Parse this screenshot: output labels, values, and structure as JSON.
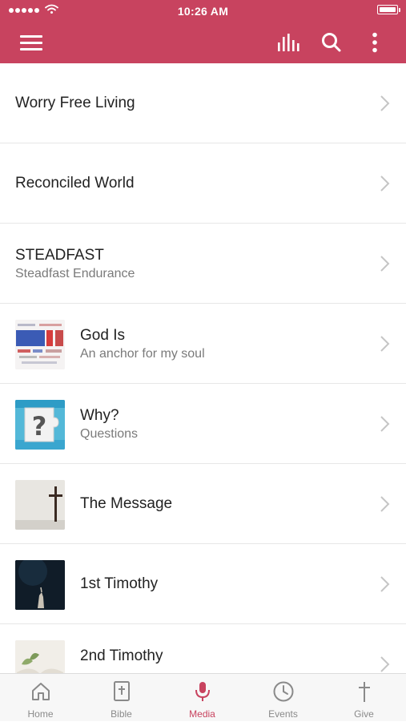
{
  "status_bar": {
    "time": "10:26 AM"
  },
  "colors": {
    "brand": "#c8435f",
    "tab_inactive": "#8a8a8a"
  },
  "header": {
    "icons": [
      "hamburger-menu-icon",
      "audio-bars-icon",
      "search-icon",
      "more-vertical-icon"
    ]
  },
  "list": {
    "items": [
      {
        "title": "Worry Free Living"
      },
      {
        "title": "Reconciled World"
      },
      {
        "title": "STEADFAST",
        "subtitle": "Steadfast Endurance"
      },
      {
        "title": "God Is",
        "subtitle": "An anchor for my soul",
        "thumbnail": "god-is-word-art"
      },
      {
        "title": "Why?",
        "subtitle": "Questions",
        "thumbnail": "question-mark-puzzle"
      },
      {
        "title": "The Message",
        "thumbnail": "cross-on-wall"
      },
      {
        "title": "1st Timothy",
        "thumbnail": "dark-reaching-hand"
      },
      {
        "title": "2nd Timothy",
        "thumbnail": "open-book-plant"
      }
    ]
  },
  "tabbar": {
    "tabs": [
      {
        "label": "Home",
        "icon": "home-icon"
      },
      {
        "label": "Bible",
        "icon": "bible-icon"
      },
      {
        "label": "Media",
        "icon": "microphone-icon",
        "active": true
      },
      {
        "label": "Events",
        "icon": "clock-icon"
      },
      {
        "label": "Give",
        "icon": "cross-icon"
      }
    ]
  }
}
